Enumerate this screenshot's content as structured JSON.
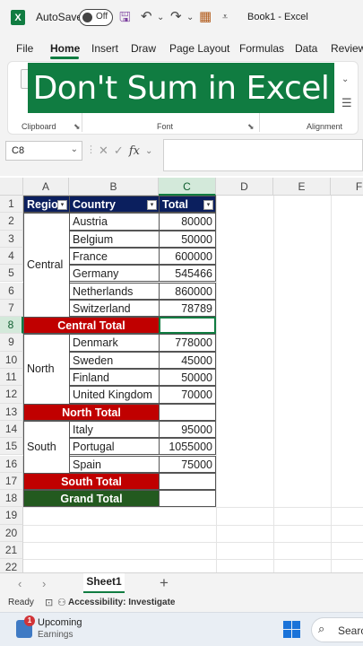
{
  "title_bar": {
    "app_logo": "X",
    "autosave_label": "AutoSave",
    "autosave_state": "Off",
    "filename": "Book1  -  Excel",
    "icons": [
      "save-icon",
      "undo-icon",
      "redo-icon",
      "table-icon",
      "customize-icon"
    ]
  },
  "ribbon": {
    "tabs": [
      "File",
      "Home",
      "Insert",
      "Draw",
      "Page Layout",
      "Formulas",
      "Data",
      "Review"
    ],
    "active_tab": "Home",
    "groups": [
      "Clipboard",
      "Font",
      "Alignment"
    ],
    "overlay_banner": "Don't Sum in Excel"
  },
  "formula_bar": {
    "name_box": "C8",
    "fx_label": "fx",
    "formula": ""
  },
  "grid": {
    "columns": [
      "A",
      "B",
      "C",
      "D",
      "E",
      "F"
    ],
    "selected_column": "C",
    "rows": [
      "1",
      "2",
      "3",
      "4",
      "5",
      "6",
      "7",
      "8",
      "9",
      "10",
      "11",
      "12",
      "13",
      "14",
      "15",
      "16",
      "17",
      "18",
      "19",
      "20",
      "21",
      "22"
    ],
    "selected_row": "8",
    "headers": {
      "region": "Regio",
      "country": "Country",
      "total": "Total"
    },
    "data": [
      {
        "row": 2,
        "country": "Austria",
        "total": "80000"
      },
      {
        "row": 3,
        "country": "Belgium",
        "total": "50000"
      },
      {
        "row": 4,
        "country": "France",
        "total": "600000"
      },
      {
        "row": 5,
        "country": "Germany",
        "total": "545466"
      },
      {
        "row": 6,
        "country": "Netherlands",
        "total": "860000"
      },
      {
        "row": 7,
        "country": "Switzerland",
        "total": "78789"
      },
      {
        "row": 9,
        "country": "Denmark",
        "total": "778000"
      },
      {
        "row": 10,
        "country": "Sweden",
        "total": "45000"
      },
      {
        "row": 11,
        "country": "Finland",
        "total": "50000"
      },
      {
        "row": 12,
        "country": "United Kingdom",
        "total": "70000"
      },
      {
        "row": 14,
        "country": "Italy",
        "total": "95000"
      },
      {
        "row": 15,
        "country": "Portugal",
        "total": "1055000"
      },
      {
        "row": 16,
        "country": "Spain",
        "total": "75000"
      }
    ],
    "regions": {
      "central": "Central",
      "north": "North",
      "south": "South"
    },
    "subtotals": {
      "central": "Central Total",
      "north": "North Total",
      "south": "South Total",
      "grand": "Grand Total"
    },
    "colors": {
      "header": "#0b1f5e",
      "subtotal": "#c00000",
      "grand_total": "#235a1f",
      "accent": "#107c41"
    }
  },
  "sheet_bar": {
    "sheet_name": "Sheet1",
    "add_label": "+"
  },
  "status_bar": {
    "ready": "Ready",
    "accessibility": "Accessibility: Investigate"
  },
  "taskbar": {
    "badge_count": "1",
    "widget_title": "Upcoming",
    "widget_subtitle": "Earnings",
    "search_label": "Searc"
  }
}
